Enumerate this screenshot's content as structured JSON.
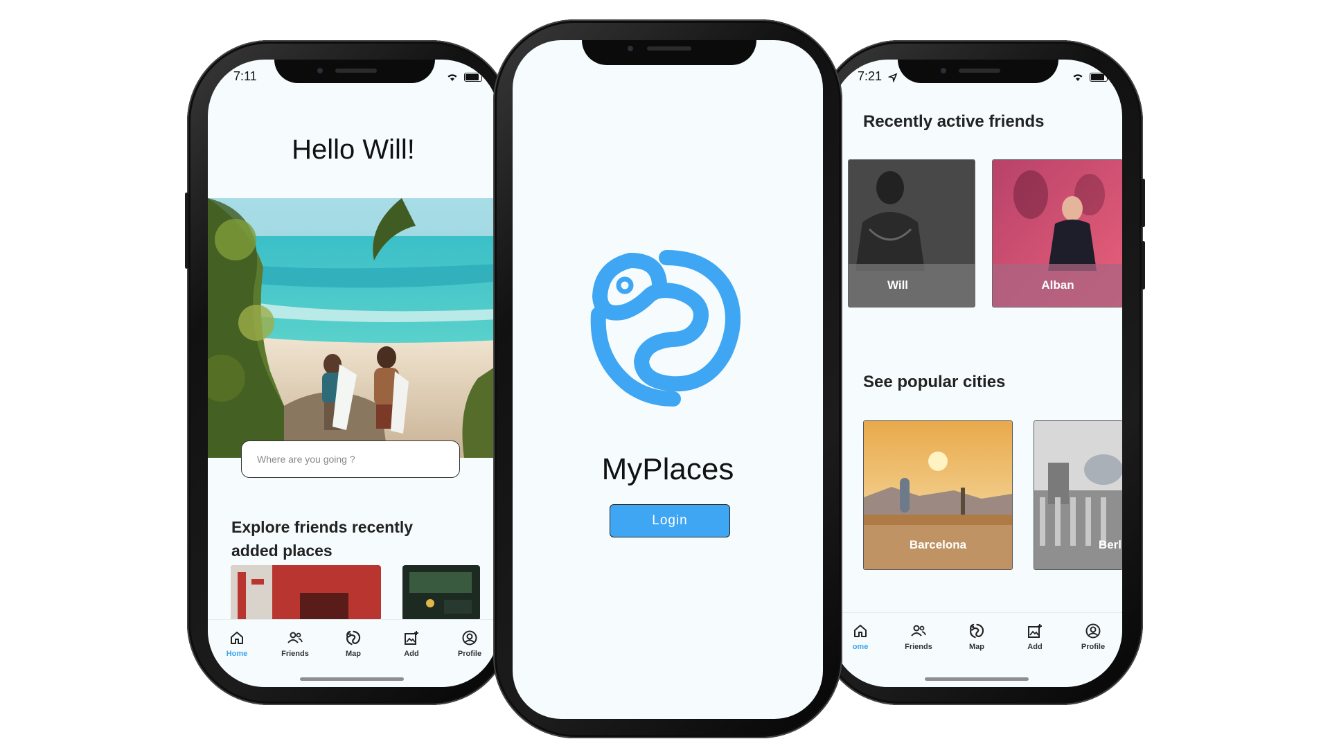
{
  "left_phone": {
    "status_time": "7:11",
    "greeting": "Hello Will!",
    "search": {
      "placeholder": "Where are you going ?"
    },
    "section_title": "Explore friends recently added places",
    "tabs": [
      {
        "label": "Home",
        "icon": "home-icon",
        "active": true
      },
      {
        "label": "Friends",
        "icon": "friends-icon",
        "active": false
      },
      {
        "label": "Map",
        "icon": "map-logo-icon",
        "active": false
      },
      {
        "label": "Add",
        "icon": "add-photo-icon",
        "active": false
      },
      {
        "label": "Profile",
        "icon": "profile-icon",
        "active": false
      }
    ]
  },
  "center_phone": {
    "app_name": "MyPlaces",
    "login_label": "Login",
    "logo_color": "#3fa6f3"
  },
  "right_phone": {
    "status_time": "7:21",
    "friends_title": "Recently active friends",
    "friends": [
      {
        "name": "Will"
      },
      {
        "name": "Alban"
      }
    ],
    "cities_title": "See popular cities",
    "cities": [
      {
        "name": "Barcelona"
      },
      {
        "name": "Berl"
      }
    ],
    "tabs": [
      {
        "label": "ome",
        "icon": "home-icon",
        "active": true
      },
      {
        "label": "Friends",
        "icon": "friends-icon",
        "active": false
      },
      {
        "label": "Map",
        "icon": "map-logo-icon",
        "active": false
      },
      {
        "label": "Add",
        "icon": "add-photo-icon",
        "active": false
      },
      {
        "label": "Profile",
        "icon": "profile-icon",
        "active": false
      }
    ]
  },
  "colors": {
    "accent": "#3fa6f3",
    "screen_bg": "#f6fcfd",
    "frame": "#111111"
  }
}
